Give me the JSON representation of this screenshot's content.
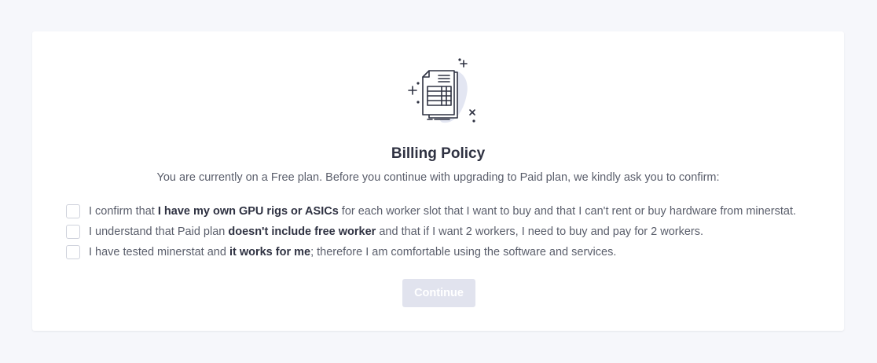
{
  "modal": {
    "icon": "document-table-icon",
    "title": "Billing Policy",
    "subtitle": "You are currently on a Free plan. Before you continue with upgrading to Paid plan, we kindly ask you to confirm:",
    "checks": [
      {
        "before": "I confirm that ",
        "bold": "I have my own GPU rigs or ASICs",
        "after": " for each worker slot that I want to buy and that I can't rent or buy hardware from minerstat.",
        "checked": false
      },
      {
        "before": "I understand that Paid plan ",
        "bold": "doesn't include free worker",
        "after": " and that if I want 2 workers, I need to buy and pay for 2 workers.",
        "checked": false
      },
      {
        "before": "I have tested minerstat and ",
        "bold": "it works for me",
        "after": "; therefore I am comfortable using the software and services.",
        "checked": false
      }
    ],
    "continue_label": "Continue",
    "continue_enabled": false
  },
  "colors": {
    "background": "#f6f7fb",
    "card": "#ffffff",
    "button_disabled": "#e1e3ee",
    "icon_blob": "#e3e6f2",
    "icon_stroke": "#2f3242"
  }
}
